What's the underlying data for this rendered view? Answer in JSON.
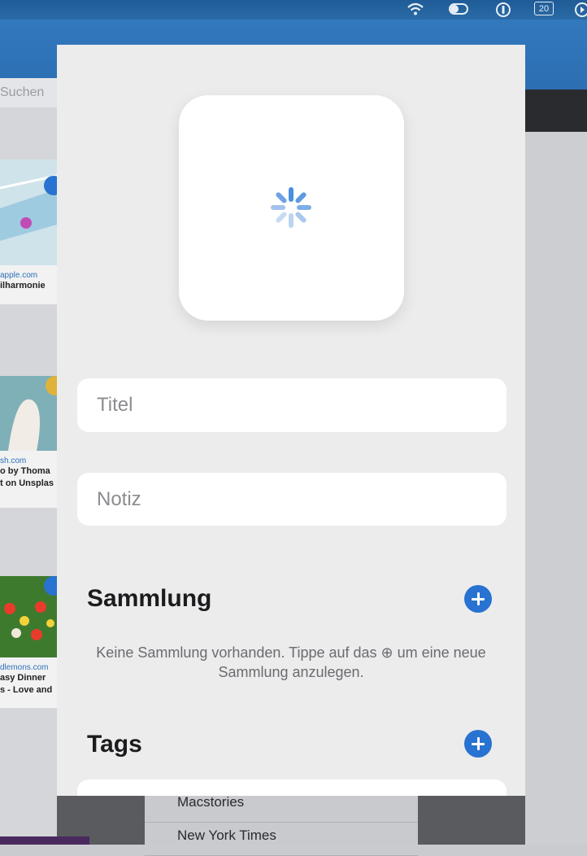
{
  "menubar": {
    "icons": [
      "wifi-icon",
      "toggle-icon",
      "password-icon",
      "calendar-icon",
      "media-icon"
    ],
    "calendar_day": "20"
  },
  "background_app": {
    "search_placeholder": "Suchen",
    "cards": [
      {
        "source": "apple.com",
        "title": "ilharmonie"
      },
      {
        "source": "sh.com",
        "title": "o by Thoma",
        "title2": "t on Unsplas"
      },
      {
        "source": "dlemons.com",
        "title": "asy Dinner",
        "title2": "s - Love and"
      }
    ],
    "bottom_list": [
      "Macstories",
      "New York Times"
    ]
  },
  "sheet": {
    "image_loading": true,
    "title_field": {
      "placeholder": "Titel",
      "value": ""
    },
    "note_field": {
      "placeholder": "Notiz",
      "value": ""
    },
    "collection": {
      "heading": "Sammlung",
      "empty_hint": "Keine Sammlung vorhanden. Tippe auf das ⊕ um eine neue Sammlung anzulegen."
    },
    "tags": {
      "heading": "Tags"
    }
  },
  "colors": {
    "accent": "#2872d1",
    "sheet_background": "#ececed",
    "menubar": "#1f5c97"
  }
}
